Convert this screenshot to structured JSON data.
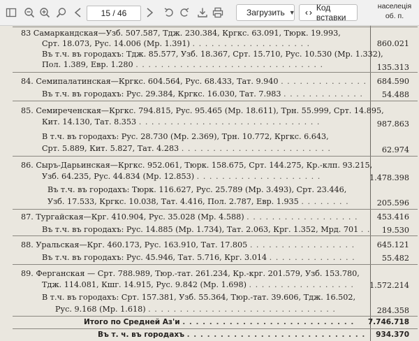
{
  "toolbar": {
    "page_indicator": "15 / 46",
    "download_label": "Загрузить",
    "embed_label": "Код вставки"
  },
  "header": {
    "col_line1": "населеція",
    "col_line2": "об. п."
  },
  "rows": [
    {
      "text": "83  Самаркандская—Узб. 507.587, Тдж. 230.384, Кргкс. 63.091, Тюрк. 19.993,"
    },
    {
      "text": "Срт. 18.073, Рус. 14.006 (Мр. 1.391)",
      "dots": ". . . . . . . . . . . . . . . . . . .",
      "value": "860.021"
    },
    {
      "text": "Въ т.ч. въ городахъ: Тдж. 85.577, Узб. 18.367, Срт. 15.710, Рус. 10.530 (Мр. 1.332),"
    },
    {
      "text": "Пол. 1.389, Евр. 1.280",
      "dots": ". . . . . . . . . . . . . . . . . . . . . . . . . . . . . .",
      "value": "135.313"
    },
    {
      "text": "84. Семипалатинская—Кргкс. 604.564, Рус. 68.433, Тат. 9.940",
      "dots": ". . . . . . . . . . . . . .",
      "value": "684.590"
    },
    {
      "text": "Въ т.ч. въ городахъ: Рус. 29.384, Кргкс. 16.030, Тат. 7.983",
      "dots": ". . . . . . . . . . . . .",
      "value": "54.488"
    },
    {
      "text": "85. Семиреченская—Кргкс. 794.815, Рус. 95.465 (Мр. 18.611), Трн. 55.999, Срт. 14.895,"
    },
    {
      "text": "Кит. 14.130, Тат. 8.353",
      "dots": ". . . . . . . . . . . . . . . . . . . . . . . . . . . . .",
      "value": "987.863"
    },
    {
      "text": "В т.ч.  въ городахъ: Рус. 28.730 (Мр. 2.369), Трн. 10.772, Кргкс. 6.643,"
    },
    {
      "text": "Срт. 5.889, Кит. 5.827, Тат. 4.283",
      "dots": ". . . . . . . . . . . . . . . . . . . . . . . .",
      "value": "62.974"
    },
    {
      "text": "86. Сыръ-Дарьинская—Кргкс. 952.061, Тюрк. 158.675, Срт. 144.275, Кр.-клп. 93.215,"
    },
    {
      "text": "Узб. 64.235, Рус. 44.834 (Мр. 12.853)",
      "dots": ". . . . . . . . . . . . . . . . . . . .",
      "value": "1.478.398"
    },
    {
      "text": "Въ т.ч.  въ городахъ:  Тюрк. 116.627, Рус. 25.789 (Мр. 3.493), Срт. 23.446,"
    },
    {
      "text": "Узб. 17.533, Кргкс. 10.038, Тат. 4.416, Пол. 2.787, Евр. 1.935",
      "dots": ". . . . . . . .",
      "value": "205.596"
    },
    {
      "text": "87. Тургайская—Крг. 410.904, Рус. 35.028 (Мр. 4.588)",
      "dots": ". . . . . . . . . . . . . . . . . .",
      "value": "453.416"
    },
    {
      "text": "Въ т.ч. въ городахъ: Рус. 14.885 (Мр. 1.734), Тат. 2.063, Крг. 1.352, Мрд. 701",
      "dots": ". .",
      "value": "19.530"
    },
    {
      "text": "88. Уральская—Крг. 460.173, Рус. 163.910, Тат. 17.805",
      "dots": ". . . . . . . . . . . . . . . . .",
      "value": "645.121"
    },
    {
      "text": "Въ т.ч. въ городахъ: Рус. 45.946, Тат. 5.716, Крг. 3.014",
      "dots": ". . . . . . . . . . . . . .",
      "value": "55.482"
    },
    {
      "text": "89. Ферганская — Срт. 788.989, Тюр.-тат. 261.234, Кр.-крг. 201.579, Узб. 153.780,"
    },
    {
      "text": "Тдж. 114.081, Кшг. 14.915, Рус. 9.842 (Мр. 1.698)",
      "dots": ". . . . . . . . . . . . . . . . .",
      "value": "1.572.214"
    },
    {
      "text": "В т.ч. въ городахъ: Срт. 157.381, Узб. 55.364, Тюр.-тат. 39.606, Тдж. 16.502,"
    },
    {
      "text": "Рус. 9.168 (Мр. 1.618)",
      "dots": ". . . . . . . . . . . . . . . . . . . . . . . . . . . . . .",
      "value": "284.358"
    }
  ],
  "totals": [
    {
      "text": "Итого по Средней Аз'и",
      "dots": ". . . . . . . . . . . . . . . . . . . . . . . . . .",
      "value": "7.746.718"
    },
    {
      "text": "Въ т. ч. въ городахъ",
      "dots": ". . . . . . . . . . . . . . . . . . . . . . . . . . .",
      "value": "934.370"
    }
  ]
}
